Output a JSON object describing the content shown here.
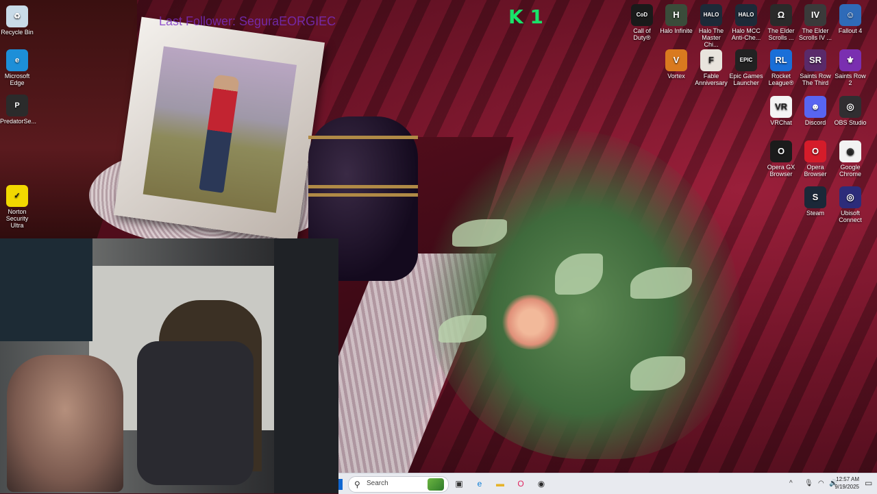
{
  "overlay": {
    "stream_title": "Last Follower: SeguraEORGIEC",
    "badge": "K 1"
  },
  "desktop": {
    "left_icons": [
      {
        "label": "Recycle Bin",
        "icon": "recycle-bin-icon",
        "glyph": "♻"
      },
      {
        "label": "Microsoft Edge",
        "icon": "edge-icon",
        "glyph": "e"
      },
      {
        "label": "PredatorSe...",
        "icon": "predator-sense-icon",
        "glyph": "P"
      },
      {
        "label": "Norton Security Ultra",
        "icon": "norton-icon",
        "glyph": "✓"
      }
    ],
    "right_icons": [
      {
        "label": "Call of Duty®",
        "icon": "call-of-duty-icon",
        "glyph": "CoD",
        "color": "#1a1a1a"
      },
      {
        "label": "Halo Infinite",
        "icon": "halo-infinite-icon",
        "glyph": "H",
        "color": "#3a4c3a"
      },
      {
        "label": "Halo The Master Chi...",
        "icon": "halo-mcc-icon",
        "glyph": "HALO",
        "color": "#1d2a38"
      },
      {
        "label": "Halo MCC Anti-Che...",
        "icon": "halo-mcc-anticheat-icon",
        "glyph": "HALO",
        "color": "#1d2a38"
      },
      {
        "label": "The Elder Scrolls ...",
        "icon": "elder-scrolls-icon",
        "glyph": "Ω",
        "color": "#2a2a2a"
      },
      {
        "label": "The Elder Scrolls IV ...",
        "icon": "oblivion-icon",
        "glyph": "IV",
        "color": "#3a3a3a"
      },
      {
        "label": "Fallout 4",
        "icon": "fallout-4-icon",
        "glyph": "☺",
        "color": "#2f6bb8"
      },
      {
        "label": "Vortex",
        "icon": "vortex-icon",
        "glyph": "V",
        "color": "#d97a1f"
      },
      {
        "label": "Fable Anniversary",
        "icon": "fable-icon",
        "glyph": "F",
        "color": "#e8e4dd"
      },
      {
        "label": "Epic Games Launcher",
        "icon": "epic-games-icon",
        "glyph": "EPIC",
        "color": "#222"
      },
      {
        "label": "Rocket League®",
        "icon": "rocket-league-icon",
        "glyph": "RL",
        "color": "#1a6fd8"
      },
      {
        "label": "Saints Row The Third",
        "icon": "saints-row-third-icon",
        "glyph": "SR",
        "color": "#5a2a6a"
      },
      {
        "label": "Saints Row 2",
        "icon": "saints-row-2-icon",
        "glyph": "⚜",
        "color": "#7a2fb0"
      },
      {
        "label": "VRChat",
        "icon": "vrchat-icon",
        "glyph": "VR",
        "color": "#f4f4f4"
      },
      {
        "label": "Discord",
        "icon": "discord-icon",
        "glyph": "☻",
        "color": "#5865f2"
      },
      {
        "label": "OBS Studio",
        "icon": "obs-studio-icon",
        "glyph": "◎",
        "color": "#302e31"
      },
      {
        "label": "Opera GX Browser",
        "icon": "opera-gx-icon",
        "glyph": "O",
        "color": "#1b1b1b"
      },
      {
        "label": "Opera Browser",
        "icon": "opera-icon",
        "glyph": "O",
        "color": "#d51c2a"
      },
      {
        "label": "Google Chrome",
        "icon": "chrome-icon",
        "glyph": "◉",
        "color": "#f2f2f2"
      },
      {
        "label": "Steam",
        "icon": "steam-icon",
        "glyph": "S",
        "color": "#1b2838"
      },
      {
        "label": "Ubisoft Connect",
        "icon": "ubisoft-connect-icon",
        "glyph": "◎",
        "color": "#2c2c7a"
      }
    ]
  },
  "taskbar": {
    "search_placeholder": "Search",
    "pinned": [
      {
        "name": "task-view-icon",
        "glyph": "▣",
        "color": "#333"
      },
      {
        "name": "edge-taskbar-icon",
        "glyph": "e",
        "color": "#0a7cd6"
      },
      {
        "name": "file-explorer-icon",
        "glyph": "▬",
        "color": "#e6b32a"
      },
      {
        "name": "opera-gx-taskbar-icon",
        "glyph": "O",
        "color": "#e0245e"
      },
      {
        "name": "obs-taskbar-icon",
        "glyph": "◉",
        "color": "#2a2a2a"
      }
    ],
    "tray": {
      "chevron": "^",
      "time": "12:57 AM",
      "date": "9/19/2025"
    }
  }
}
